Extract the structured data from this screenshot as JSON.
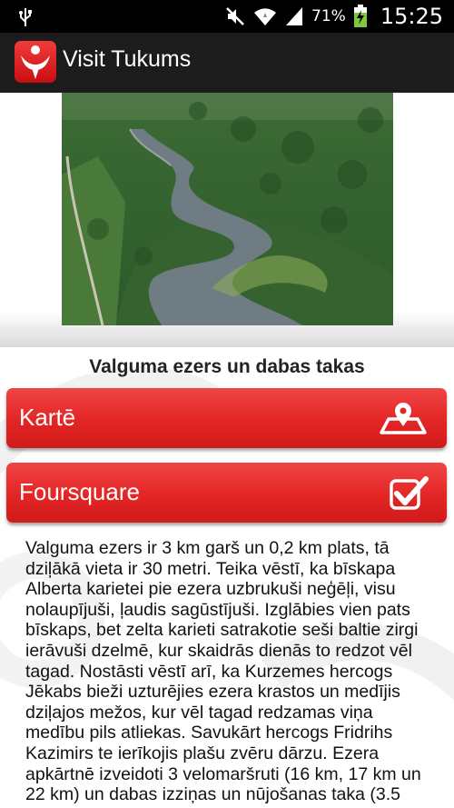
{
  "status_bar": {
    "battery_percent": "71%",
    "time": "15:25",
    "icons": [
      "usb-icon",
      "mute-icon",
      "wifi-icon",
      "signal-icon",
      "battery-charging-icon"
    ]
  },
  "action_bar": {
    "title": "Visit Tukums",
    "logo_icon": "app-logo-icon"
  },
  "place": {
    "title": "Valguma ezers un dabas takas",
    "image": "lake-aerial-photo"
  },
  "buttons": {
    "map_label": "Kartē",
    "map_icon": "map-pin-icon",
    "foursquare_label": "Foursquare",
    "foursquare_icon": "check-in-icon"
  },
  "description": "Valguma ezers ir 3 km garš un 0,2 km plats, tā dziļākā vieta ir 30 metri. Teika vēstī, ka bīskapa Alberta karietei pie ezera uzbrukuši neģēļi, visu nolaupījuši, ļaudis sagūstījuši. Izglābies vien pats bīskaps, bet zelta karieti satrakotie seši baltie zirgi ierāvuši dzelmē, kur skaidrās dienās to redzot vēl tagad. Nostāsti vēstī arī, ka Kurzemes hercogs Jēkabs bieži uzturējies ezera krastos un medījis dziļajos mežos, kur vēl tagad redzamas viņa medību pils atliekas. Savukārt hercogs Fridrihs Kazimirs te ierīkojis plašu zvēru dārzu. Ezera apkārtnē izveidoti 3 velomaršruti (16 km, 17 km un 22 km) un dabas izziņas un nūjošanas taka (3.5",
  "colors": {
    "accent_red": "#e32525",
    "action_bar": "#1c1c1c",
    "status_bar": "#000000"
  }
}
